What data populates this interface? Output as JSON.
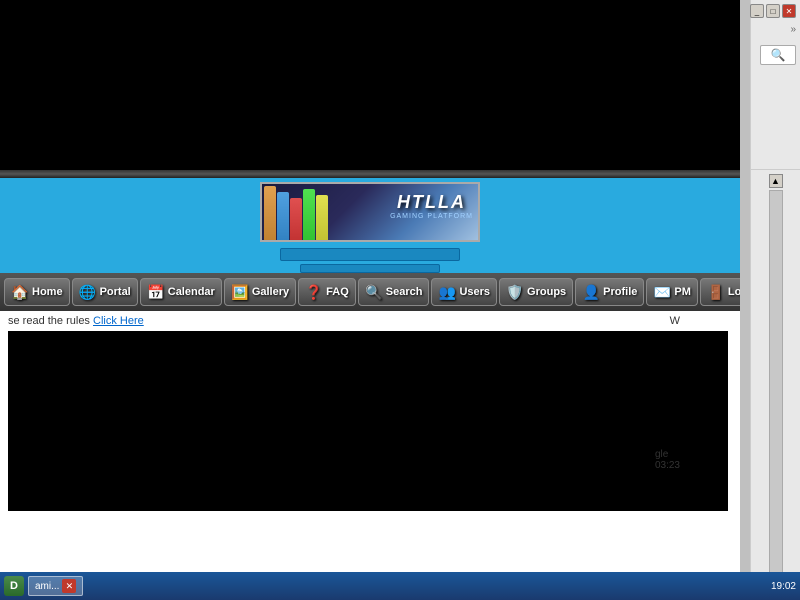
{
  "window": {
    "title": "Gaming Platform",
    "controls": {
      "minimize": "_",
      "maximize": "□",
      "close": "✕"
    }
  },
  "banner": {
    "title": "HTLLA",
    "subtitle": "GAMING PLATFORM"
  },
  "nav": {
    "items": [
      {
        "id": "home",
        "label": "Home",
        "icon": "🏠"
      },
      {
        "id": "portal",
        "label": "Portal",
        "icon": "🌐"
      },
      {
        "id": "calendar",
        "label": "Calendar",
        "icon": "📅"
      },
      {
        "id": "gallery",
        "label": "Gallery",
        "icon": "🖼️"
      },
      {
        "id": "faq",
        "label": "FAQ",
        "icon": "❓"
      },
      {
        "id": "search",
        "label": "Search",
        "icon": "🔍"
      },
      {
        "id": "users",
        "label": "Users",
        "icon": "👥"
      },
      {
        "id": "groups",
        "label": "Groups",
        "icon": "🛡️"
      },
      {
        "id": "profile",
        "label": "Profile",
        "icon": "👤"
      },
      {
        "id": "pm",
        "label": "PM",
        "icon": "✉️"
      },
      {
        "id": "logout",
        "label": "Log O",
        "icon": "🚪"
      }
    ]
  },
  "content": {
    "rules_text": "se read the rules",
    "click_here": "Click Here",
    "w_label": "W"
  },
  "bottom_info": {
    "label": "gle",
    "time": "03:23"
  },
  "taskbar": {
    "start_label": "D",
    "taskbar_item": "ami...",
    "close_label": "✕",
    "time": "19:02"
  }
}
